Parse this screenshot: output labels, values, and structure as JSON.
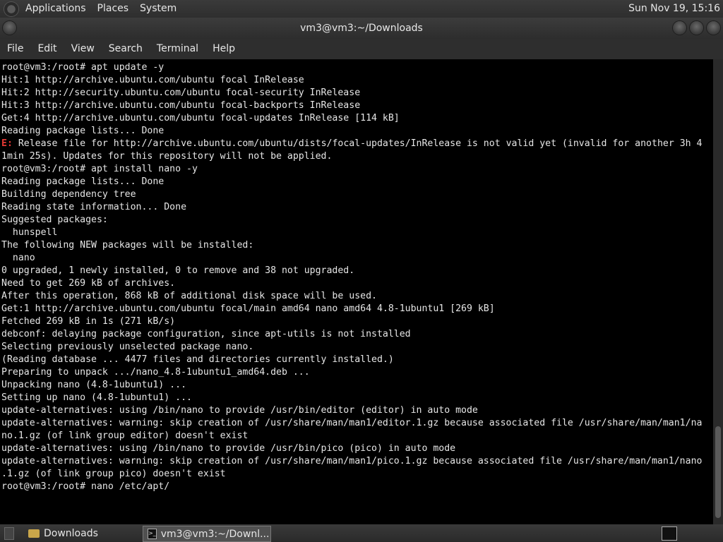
{
  "panel": {
    "menu": [
      "Applications",
      "Places",
      "System"
    ],
    "clock": "Sun Nov 19, 15:16"
  },
  "window": {
    "title": "vm3@vm3:~/Downloads"
  },
  "menubar": [
    "File",
    "Edit",
    "View",
    "Search",
    "Terminal",
    "Help"
  ],
  "terminal": {
    "lines": [
      "root@vm3:/root# apt update -y",
      "Hit:1 http://archive.ubuntu.com/ubuntu focal InRelease",
      "Hit:2 http://security.ubuntu.com/ubuntu focal-security InRelease",
      "Hit:3 http://archive.ubuntu.com/ubuntu focal-backports InRelease",
      "Get:4 http://archive.ubuntu.com/ubuntu focal-updates InRelease [114 kB]",
      "Reading package lists... Done",
      "Release file for http://archive.ubuntu.com/ubuntu/dists/focal-updates/InRelease is not valid yet (invalid for another 3h 4",
      "1min 25s). Updates for this repository will not be applied.",
      "root@vm3:/root# apt install nano -y",
      "Reading package lists... Done",
      "Building dependency tree",
      "Reading state information... Done",
      "Suggested packages:",
      "  hunspell",
      "The following NEW packages will be installed:",
      "  nano",
      "0 upgraded, 1 newly installed, 0 to remove and 38 not upgraded.",
      "Need to get 269 kB of archives.",
      "After this operation, 868 kB of additional disk space will be used.",
      "Get:1 http://archive.ubuntu.com/ubuntu focal/main amd64 nano amd64 4.8-1ubuntu1 [269 kB]",
      "Fetched 269 kB in 1s (271 kB/s)",
      "debconf: delaying package configuration, since apt-utils is not installed",
      "Selecting previously unselected package nano.",
      "(Reading database ... 4477 files and directories currently installed.)",
      "Preparing to unpack .../nano_4.8-1ubuntu1_amd64.deb ...",
      "Unpacking nano (4.8-1ubuntu1) ...",
      "Setting up nano (4.8-1ubuntu1) ...",
      "update-alternatives: using /bin/nano to provide /usr/bin/editor (editor) in auto mode",
      "update-alternatives: warning: skip creation of /usr/share/man/man1/editor.1.gz because associated file /usr/share/man/man1/na",
      "no.1.gz (of link group editor) doesn't exist",
      "update-alternatives: using /bin/nano to provide /usr/bin/pico (pico) in auto mode",
      "update-alternatives: warning: skip creation of /usr/share/man/man1/pico.1.gz because associated file /usr/share/man/man1/nano",
      ".1.gz (of link group pico) doesn't exist",
      "root@vm3:/root# nano /etc/apt/"
    ],
    "error_prefix": "E:",
    "error_line_index": 6,
    "error_color": "#e53935"
  },
  "taskbar": {
    "tasks": [
      "Downloads",
      "vm3@vm3:~/Downl..."
    ]
  }
}
